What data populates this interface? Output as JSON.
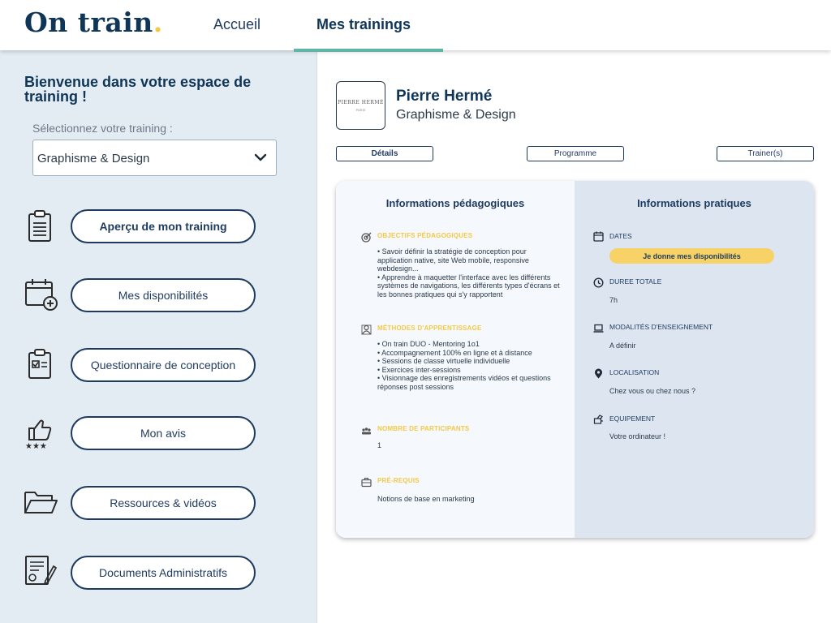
{
  "header": {
    "logo_text": "On train",
    "logo_dot": ".",
    "nav": {
      "home": "Accueil",
      "trainings": "Mes trainings"
    }
  },
  "sidebar": {
    "welcome": "Bienvenue dans votre espace de training !",
    "select_label": "Sélectionnez votre training :",
    "select_value": "Graphisme & Design",
    "menu": [
      {
        "label": "Aperçu de mon training",
        "icon": "clipboard-list-icon"
      },
      {
        "label": "Mes disponibilités",
        "icon": "calendar-add-icon"
      },
      {
        "label": "Questionnaire de conception",
        "icon": "clipboard-check-icon"
      },
      {
        "label": "Mon avis",
        "icon": "thumbs-up-stars-icon"
      },
      {
        "label": "Ressources & vidéos",
        "icon": "folder-icon"
      },
      {
        "label": "Documents Administratifs",
        "icon": "document-sign-icon"
      }
    ]
  },
  "trainer": {
    "logo_text": "PIERRE HERMÉ",
    "logo_sub": "PARIS",
    "name": "Pierre Hermé",
    "training": "Graphisme & Design"
  },
  "tabs": {
    "details": "Détails",
    "programme": "Programme",
    "trainers": "Trainer(s)"
  },
  "pedagogic": {
    "title": "Informations pédagogiques",
    "objectives_title": "OBJECTIFS PÉDAGOGIQUES",
    "objectives": [
      "• Savoir définir la stratégie de conception pour application native, site Web mobile, responsive webdesign...",
      "• Apprendre à maquetter l'interface avec les différents systèmes de navigations, les différents types d'écrans et les bonnes pratiques qui s'y rapportent"
    ],
    "methods_title": "MÉTHODES D'APPRENTISSAGE",
    "methods": [
      "• On train DUO - Mentoring 1o1",
      "• Accompagnement 100% en ligne et à distance",
      "• Sessions de classe virtuelle individuelle",
      "• Exercices inter-sessions",
      "• Visionnage des enregistrements vidéos et questions réponses post sessions"
    ],
    "participants_title": "NOMBRE DE PARTICIPANTS",
    "participants_value": "1",
    "prereq_title": "PRÉ-REQUIS",
    "prereq_value": "Notions de base en marketing"
  },
  "practical": {
    "title": "Informations pratiques",
    "dates_title": "DATES",
    "dates_button": "Je donne mes disponibilités",
    "duration_title": "DUREE TOTALE",
    "duration_value": "7h",
    "modalities_title": "MODALITÉS D'ENSEIGNEMENT",
    "modalities_value": "A définir",
    "location_title": "LOCALISATION",
    "location_value": "Chez vous ou chez nous ?",
    "equipment_title": "EQUIPEMENT",
    "equipment_value": "Votre ordinateur !"
  },
  "colors": {
    "primary": "#0f3557",
    "accent": "#f5c842",
    "teal": "#5fb5a6",
    "sidebar_bg": "#e3ebf3"
  }
}
